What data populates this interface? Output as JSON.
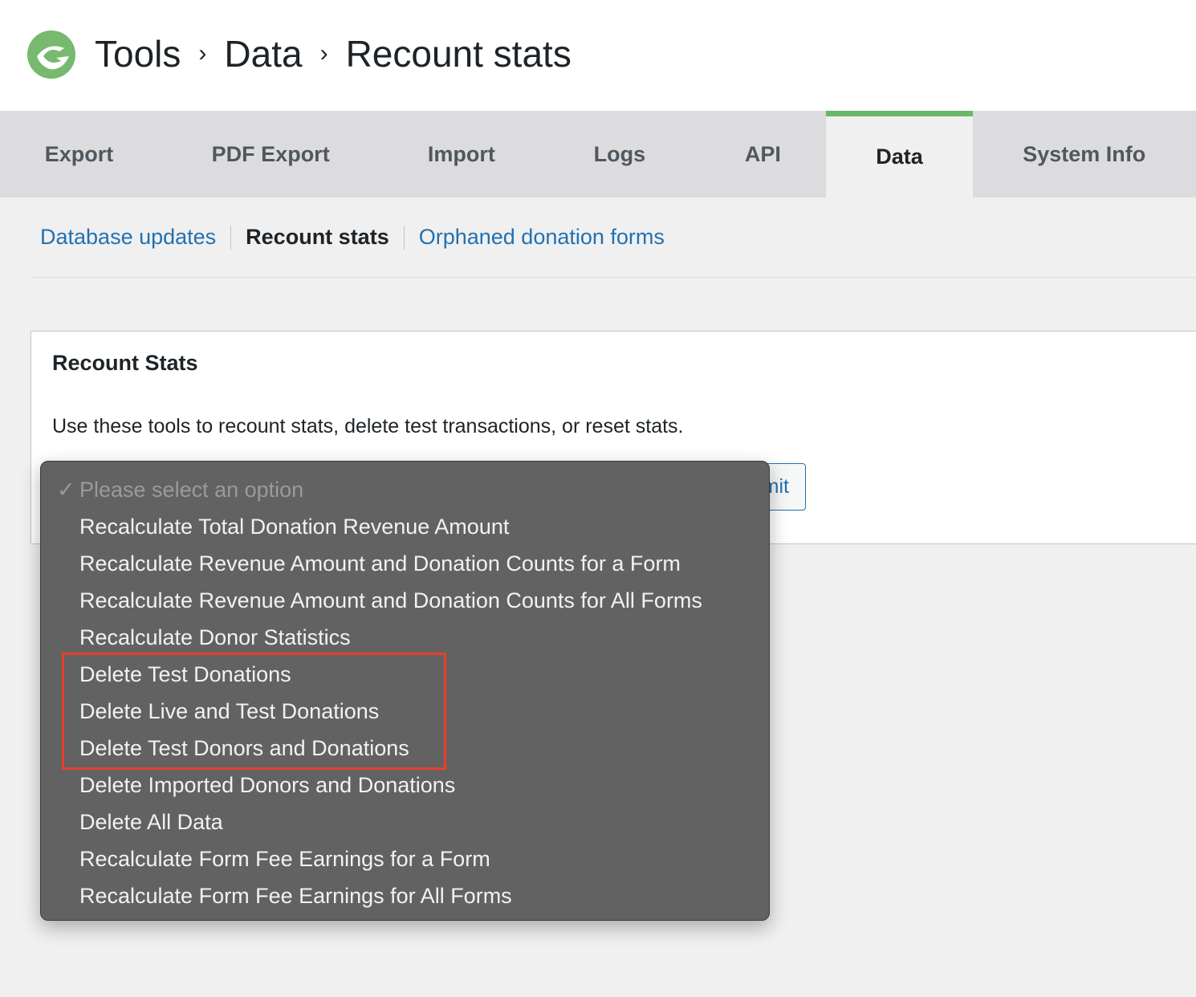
{
  "breadcrumb": [
    "Tools",
    "Data",
    "Recount stats"
  ],
  "tabs": [
    {
      "label": "Export"
    },
    {
      "label": "PDF Export"
    },
    {
      "label": "Import"
    },
    {
      "label": "Logs"
    },
    {
      "label": "API"
    },
    {
      "label": "Data"
    },
    {
      "label": "System Info"
    }
  ],
  "subnav": {
    "db": "Database updates",
    "recount": "Recount stats",
    "orphaned": "Orphaned donation forms"
  },
  "panel": {
    "title": "Recount Stats",
    "description": "Use these tools to recount stats, delete test transactions, or reset stats.",
    "submit": "Submit"
  },
  "dropdown": {
    "placeholder": "Please select an option",
    "options": [
      "Recalculate Total Donation Revenue Amount",
      "Recalculate Revenue Amount and Donation Counts for a Form",
      "Recalculate Revenue Amount and Donation Counts for All Forms",
      "Recalculate Donor Statistics",
      "Delete Test Donations",
      "Delete Live and Test Donations",
      "Delete Test Donors and Donations",
      "Delete Imported Donors and Donations",
      "Delete All Data",
      "Recalculate Form Fee Earnings for a Form",
      "Recalculate Form Fee Earnings for All Forms"
    ]
  },
  "colors": {
    "brand": "#69b86b",
    "link": "#2271b1",
    "highlight": "#e8402a"
  }
}
